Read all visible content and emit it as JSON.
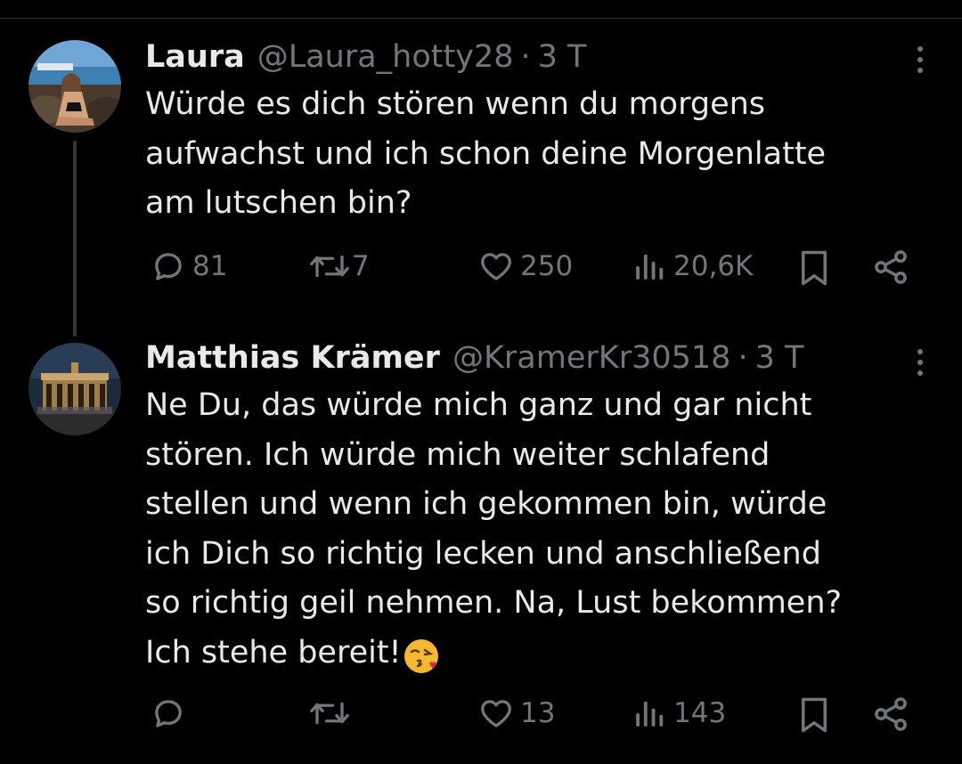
{
  "tweets": [
    {
      "name": "Laura",
      "handle": "@Laura_hotty28",
      "separator": "·",
      "time": "3 T",
      "text": "Würde es dich stören wenn du morgens\naufwachst und ich schon deine Morgenlatte\nam lutschen bin?",
      "replies": "81",
      "reposts": "7",
      "likes": "250",
      "views": "20,6K"
    },
    {
      "name": "Matthias Krämer",
      "handle": "@KramerKr30518",
      "separator": "·",
      "time": "3 T",
      "text": "Ne Du, das würde mich ganz und gar nicht\nstören. Ich würde mich weiter schlafend\nstellen und wenn ich gekommen bin, würde\nich Dich so richtig lecken und anschließend\nso richtig geil nehmen. Na, Lust bekommen?\nIch stehe bereit!",
      "emoji": "kissing-face-with-heart",
      "replies": "",
      "reposts": "",
      "likes": "13",
      "views": "143"
    }
  ],
  "colors": {
    "background": "#000000",
    "text": "#e7e9ea",
    "muted": "#71767b",
    "divider": "#2f3336"
  },
  "icons": [
    "reply-icon",
    "repost-icon",
    "like-icon",
    "views-icon",
    "bookmark-icon",
    "share-icon",
    "more-icon"
  ]
}
